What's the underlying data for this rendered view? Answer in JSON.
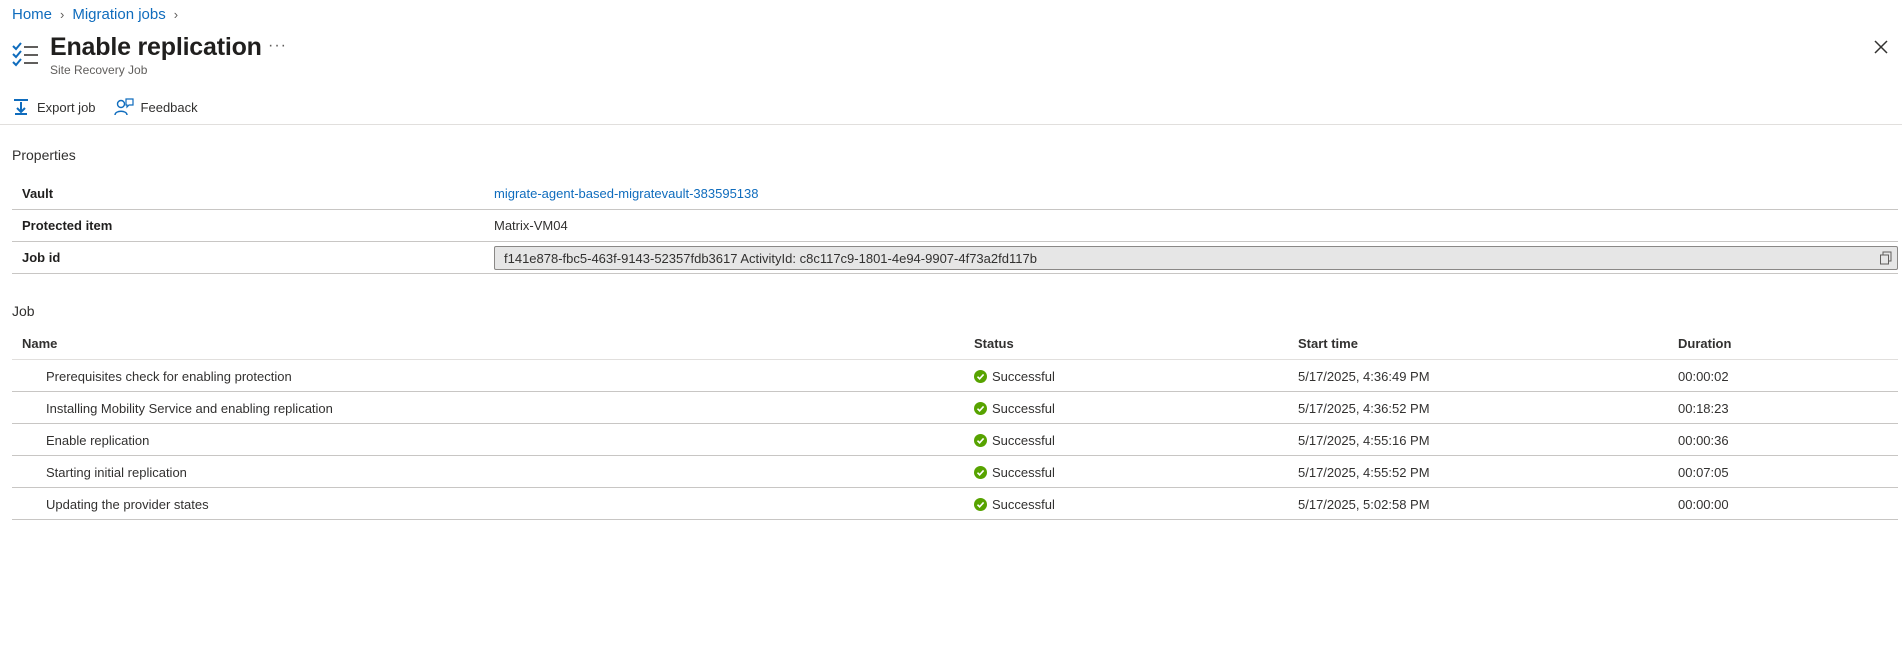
{
  "breadcrumb": {
    "home": "Home",
    "migration_jobs": "Migration jobs"
  },
  "header": {
    "title": "Enable replication",
    "subtitle": "Site Recovery Job",
    "more": "···"
  },
  "toolbar": {
    "export_label": "Export job",
    "feedback_label": "Feedback"
  },
  "properties": {
    "section_title": "Properties",
    "vault_label": "Vault",
    "vault_value": "migrate-agent-based-migratevault-383595138",
    "protected_item_label": "Protected item",
    "protected_item_value": "Matrix-VM04",
    "job_id_label": "Job id",
    "job_id_value": "f141e878-fbc5-463f-9143-52357fdb3617 ActivityId: c8c117c9-1801-4e94-9907-4f73a2fd117b"
  },
  "job": {
    "section_title": "Job",
    "columns": {
      "name": "Name",
      "status": "Status",
      "start_time": "Start time",
      "duration": "Duration"
    },
    "rows": [
      {
        "name": "Prerequisites check for enabling protection",
        "status": "Successful",
        "start_time": "5/17/2025, 4:36:49 PM",
        "duration": "00:00:02"
      },
      {
        "name": "Installing Mobility Service and enabling replication",
        "status": "Successful",
        "start_time": "5/17/2025, 4:36:52 PM",
        "duration": "00:18:23"
      },
      {
        "name": "Enable replication",
        "status": "Successful",
        "start_time": "5/17/2025, 4:55:16 PM",
        "duration": "00:00:36"
      },
      {
        "name": "Starting initial replication",
        "status": "Successful",
        "start_time": "5/17/2025, 4:55:52 PM",
        "duration": "00:07:05"
      },
      {
        "name": "Updating the provider states",
        "status": "Successful",
        "start_time": "5/17/2025, 5:02:58 PM",
        "duration": "00:00:00"
      }
    ]
  },
  "icons": {
    "blade": "checklist-icon",
    "more": "ellipsis-icon",
    "close": "close-icon",
    "export": "download-icon",
    "feedback": "feedback-icon",
    "copy": "copy-icon",
    "status": "success-check-icon"
  },
  "colors": {
    "link": "#0f6cbd",
    "success": "#57a300",
    "field_bg": "#e6e6e6"
  }
}
